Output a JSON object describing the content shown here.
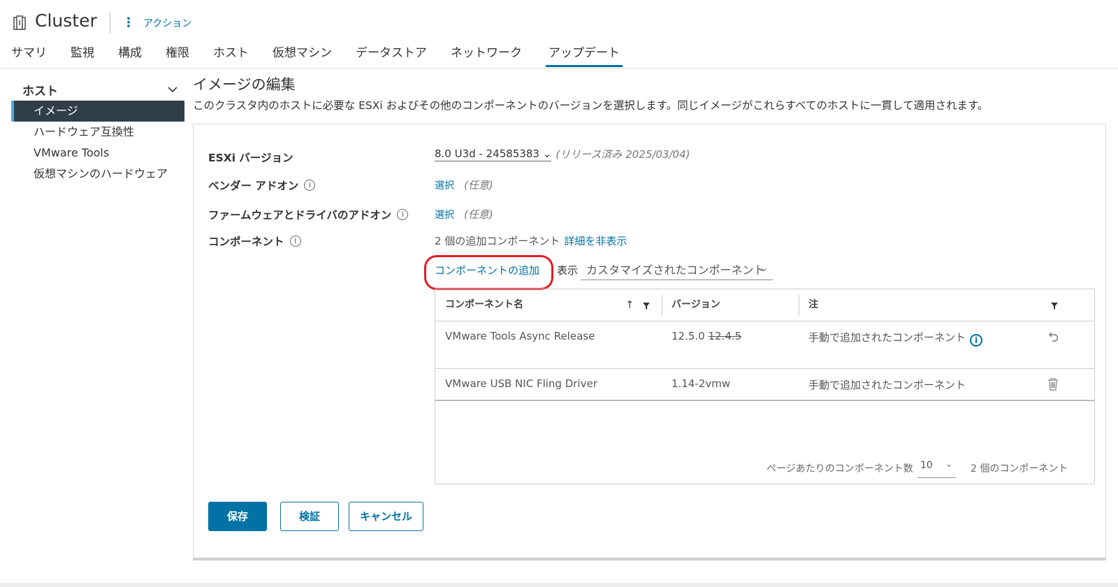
{
  "header": {
    "title": "Cluster",
    "actions_label": "アクション",
    "tabs": [
      "サマリ",
      "監視",
      "構成",
      "権限",
      "ホスト",
      "仮想マシン",
      "データストア",
      "ネットワーク",
      "アップデート"
    ],
    "active_tab": "アップデート"
  },
  "sidebar": {
    "heading": "ホスト",
    "items": [
      "イメージ",
      "ハードウェア互換性",
      "VMware Tools",
      "仮想マシンのハードウェア"
    ]
  },
  "main": {
    "title": "イメージの編集",
    "description": "このクラスタ内のホストに必要な ESXi およびその他のコンポーネントのバージョンを選択します。同じイメージがこれらすべてのホストに一貫して適用されます。"
  },
  "form": {
    "esxi_label": "ESXi バージョン",
    "esxi_version": "8.0 U3d - 24585383",
    "esxi_release": "(リリース済み 2025/03/04)",
    "vendor_label": "ベンダー アドオン",
    "vendor_select": "選択",
    "vendor_optional": "(任意)",
    "firmware_label": "ファームウェアとドライバのアドオン",
    "firmware_select": "選択",
    "firmware_optional": "(任意)",
    "components_label": "コンポーネント",
    "components_summary": "2 個の追加コンポーネント",
    "hide_details": "詳細を非表示",
    "add_component": "コンポーネントの追加",
    "show_label": "表示",
    "show_value": "カスタマイズされたコンポーネント"
  },
  "grid": {
    "columns": [
      "コンポーネント名",
      "バージョン",
      "注"
    ],
    "rows": [
      {
        "name": "VMware Tools Async Release",
        "version": "12.5.0",
        "old_version": "12.4.5",
        "note": "手動で追加されたコンポーネント"
      },
      {
        "name": "VMware USB NIC Fling Driver",
        "version": "1.14-2vmw",
        "note": "手動で追加されたコンポーネント"
      }
    ],
    "per_page_label": "ページあたりのコンポーネント数",
    "per_page_value": "10",
    "total": "2 個のコンポーネント"
  },
  "buttons": {
    "save": "保存",
    "validate": "検証",
    "cancel": "キャンセル"
  }
}
